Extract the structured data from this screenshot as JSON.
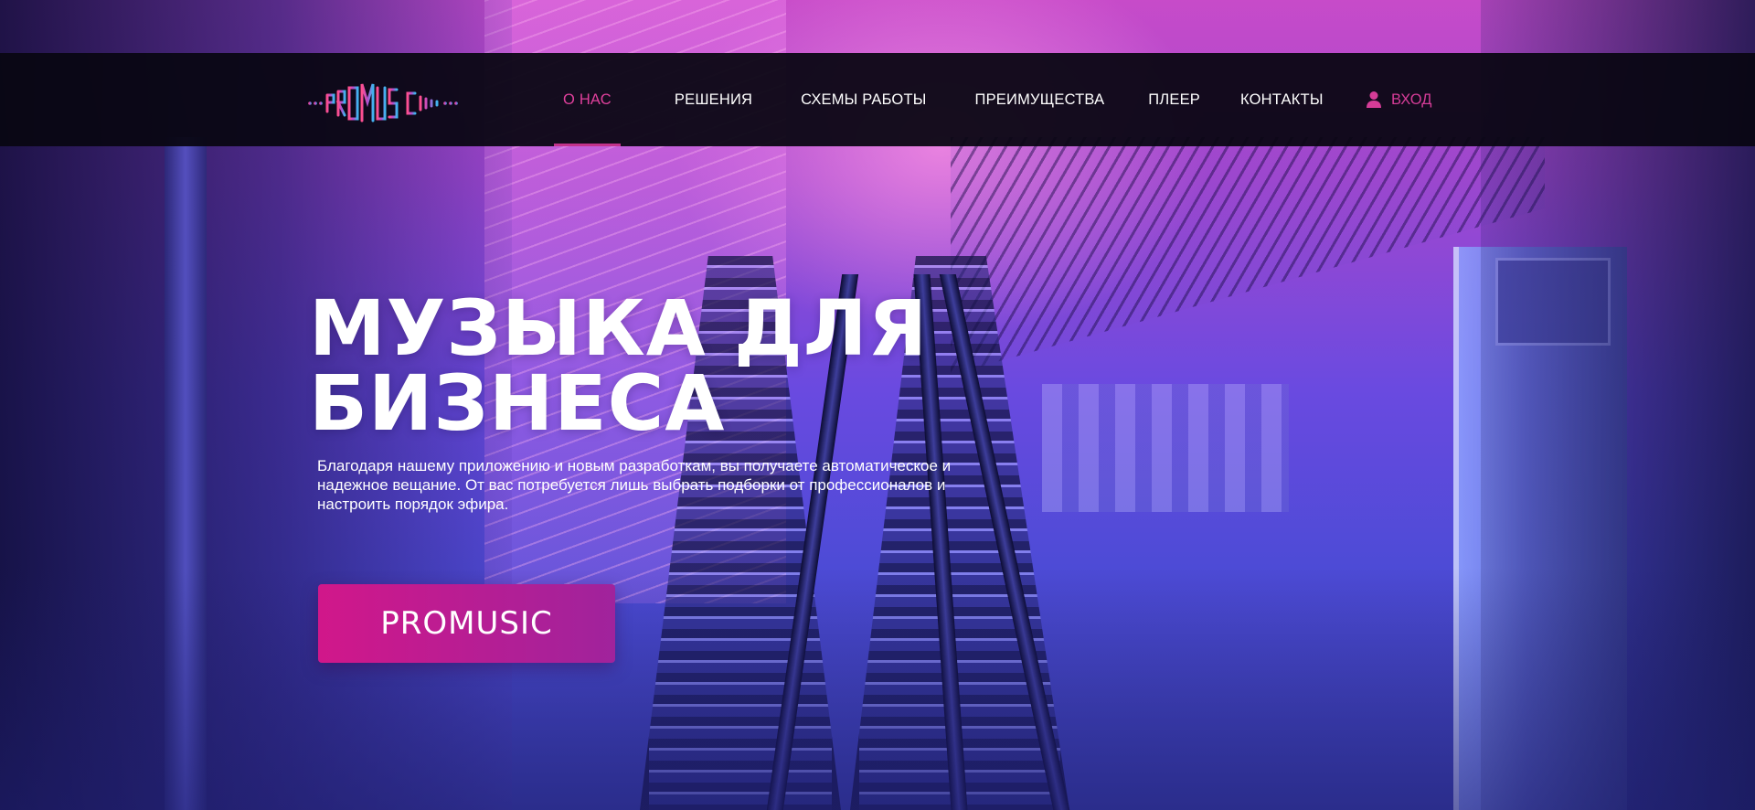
{
  "logo": {
    "text": "PROMUSIC",
    "alt": "PROMUSIC"
  },
  "nav": {
    "items": [
      {
        "label": "О НАС",
        "active": true
      },
      {
        "label": "РЕШЕНИЯ",
        "active": false
      },
      {
        "label": "СХЕМЫ РАБОТЫ",
        "active": false
      },
      {
        "label": "ПРЕИМУЩЕСТВА",
        "active": false
      },
      {
        "label": "ПЛЕЕР",
        "active": false
      },
      {
        "label": "КОНТАКТЫ",
        "active": false
      }
    ],
    "login_label": "ВХОД",
    "login_icon": "user-icon"
  },
  "hero": {
    "title_line1": "МУЗЫКА ДЛЯ",
    "title_line2": "БИЗНЕСА",
    "description": "Благодаря нашему приложению и новым разработкам, вы получаете автоматическое и надежное вещание. От вас потребуется лишь выбрать подборки от профессионалов и настроить порядок эфира.",
    "cta_label": "PROMUSIC"
  },
  "colors": {
    "accent": "#d53c97",
    "nav_bg": "#08060f",
    "cta_start": "#d1178a",
    "cta_end": "#a0239c"
  }
}
